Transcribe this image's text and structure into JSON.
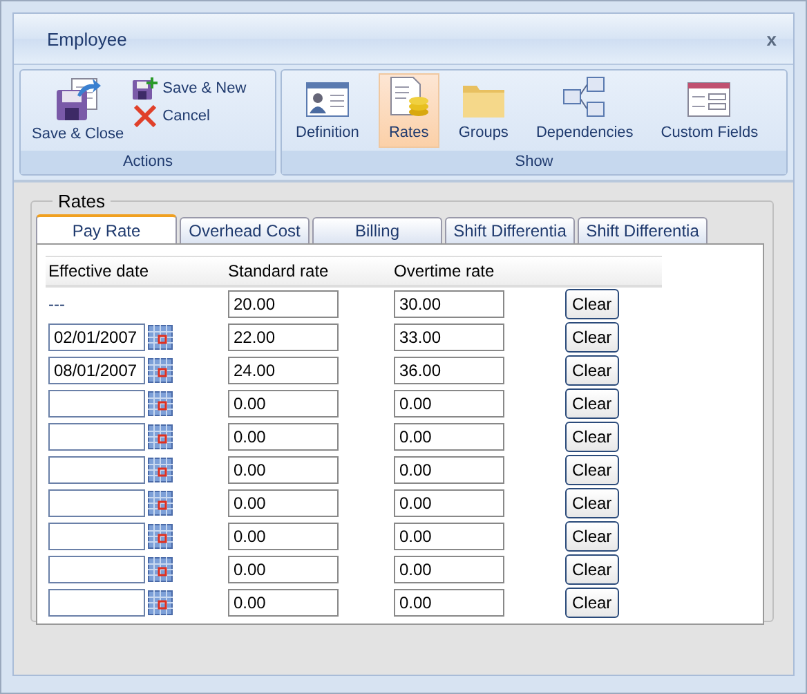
{
  "window": {
    "title": "Employee",
    "close": "x"
  },
  "ribbon": {
    "groups": [
      {
        "label": "Actions",
        "kind": "actions",
        "large": {
          "label": "Save & Close"
        },
        "small": [
          {
            "label": "Save & New",
            "kind": "save-new"
          },
          {
            "label": "Cancel",
            "kind": "cancel"
          }
        ]
      },
      {
        "label": "Show",
        "kind": "show",
        "items": [
          {
            "label": "Definition",
            "kind": "card",
            "selected": false
          },
          {
            "label": "Rates",
            "kind": "rates",
            "selected": true
          },
          {
            "label": "Groups",
            "kind": "folder",
            "selected": false
          },
          {
            "label": "Dependencies",
            "kind": "deps",
            "selected": false
          },
          {
            "label": "Custom Fields",
            "kind": "fields",
            "selected": false
          }
        ]
      }
    ]
  },
  "rates": {
    "legend": "Rates",
    "tabs": [
      {
        "label": "Pay Rate",
        "selected": true
      },
      {
        "label": "Overhead Cost",
        "selected": false
      },
      {
        "label": "Billing",
        "selected": false
      },
      {
        "label": "Shift Differentia",
        "selected": false
      },
      {
        "label": "Shift Differentia",
        "selected": false
      }
    ],
    "columns": [
      "Effective date",
      "Standard rate",
      "Overtime rate"
    ],
    "rows": [
      {
        "kind": "label",
        "date": "---",
        "standard": "20.00",
        "overtime": "30.00",
        "action": "Clear"
      },
      {
        "kind": "picker",
        "date": "02/01/2007",
        "standard": "22.00",
        "overtime": "33.00",
        "action": "Clear"
      },
      {
        "kind": "picker",
        "date": "08/01/2007",
        "standard": "24.00",
        "overtime": "36.00",
        "action": "Clear"
      },
      {
        "kind": "picker",
        "standard": "0.00",
        "overtime": "0.00",
        "action": "Clear"
      },
      {
        "kind": "picker",
        "standard": "0.00",
        "overtime": "0.00",
        "action": "Clear"
      },
      {
        "kind": "picker",
        "standard": "0.00",
        "overtime": "0.00",
        "action": "Clear"
      },
      {
        "kind": "picker",
        "standard": "0.00",
        "overtime": "0.00",
        "action": "Clear"
      },
      {
        "kind": "picker",
        "standard": "0.00",
        "overtime": "0.00",
        "action": "Clear"
      },
      {
        "kind": "picker",
        "standard": "0.00",
        "overtime": "0.00",
        "action": "Clear"
      },
      {
        "kind": "picker",
        "standard": "0.00",
        "overtime": "0.00",
        "action": "Clear"
      }
    ]
  }
}
